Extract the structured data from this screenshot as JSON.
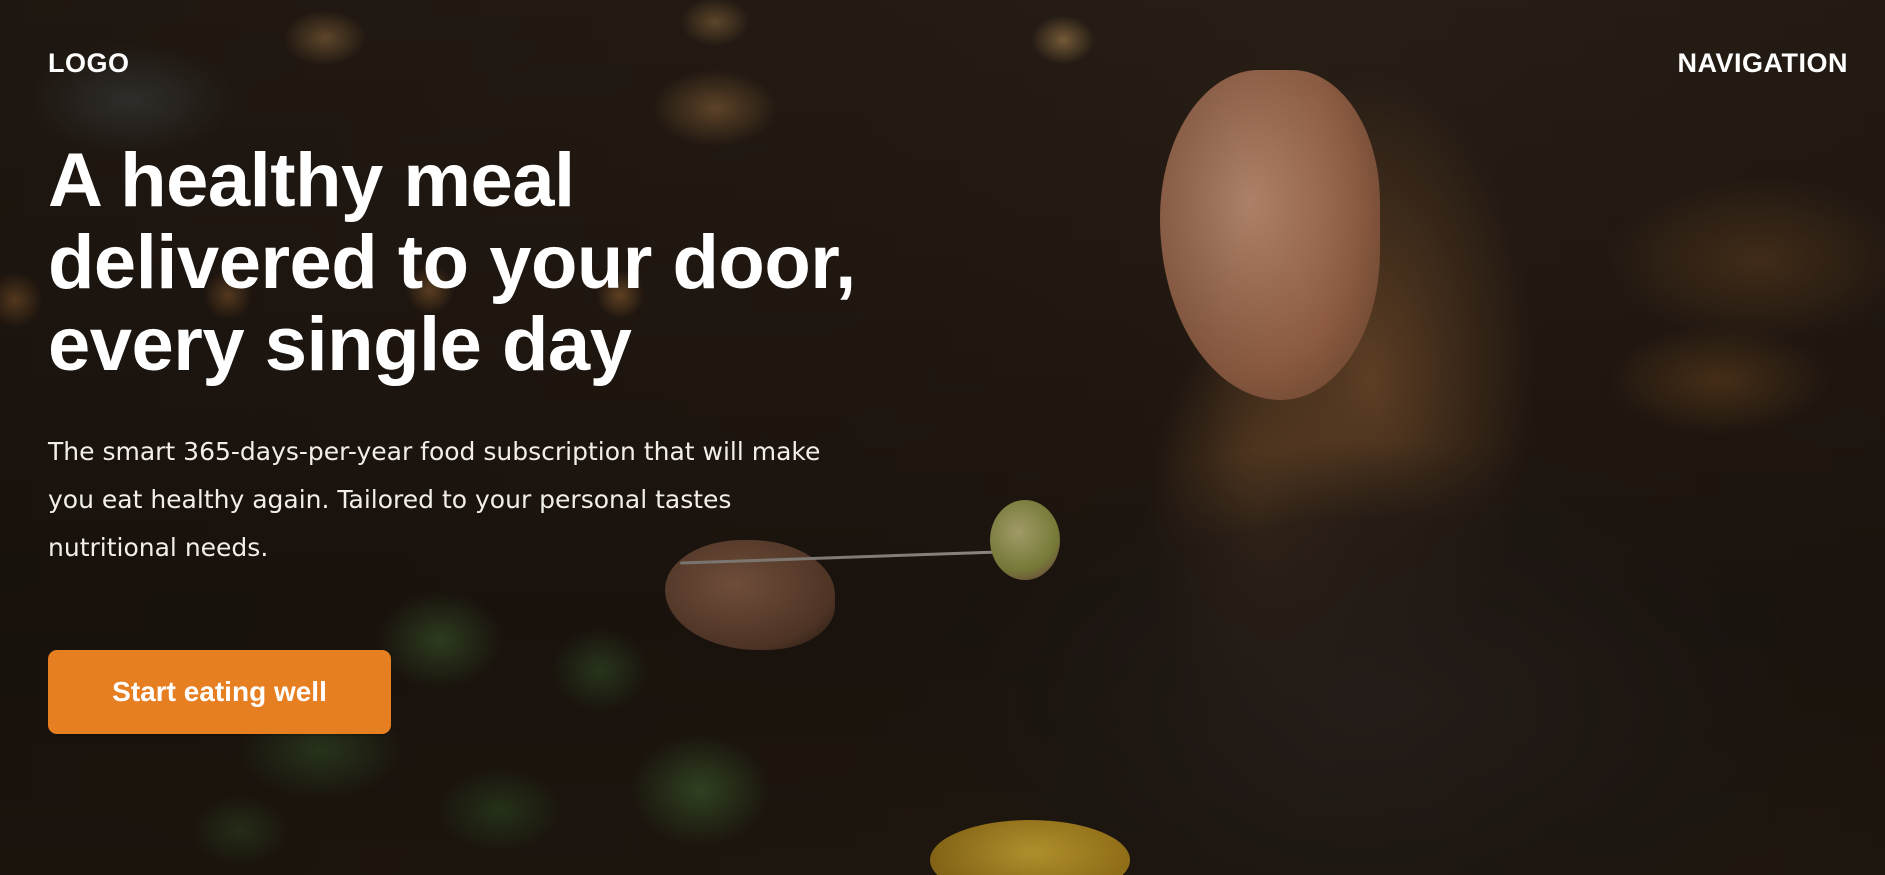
{
  "header": {
    "logo": "LOGO",
    "navigation": "NAVIGATION"
  },
  "hero": {
    "headline_lines": [
      "A healthy meal",
      "delivered to your door,",
      "every single day"
    ],
    "description_lines": [
      "The smart 365-days-per-year food subscription that will make",
      "you eat healthy again. Tailored to your personal tastes",
      "nutritional needs."
    ],
    "cta_label": "Start eating well"
  },
  "colors": {
    "accent": "#e67e22",
    "text": "#ffffff"
  }
}
